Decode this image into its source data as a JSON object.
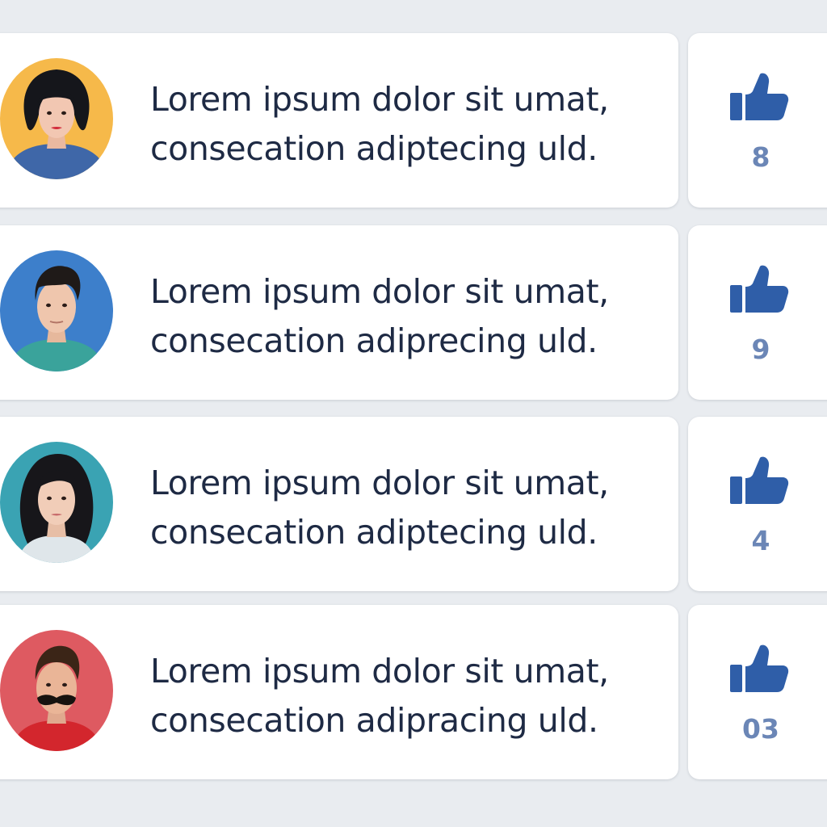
{
  "colors": {
    "background": "#e9ecf0",
    "card": "#ffffff",
    "text": "#1e2a44",
    "like_icon": "#2f5ea8",
    "like_count": "#6b86b6"
  },
  "posts": [
    {
      "avatar_icon": "avatar-woman-short-dark-hair",
      "avatar_bg": "#f6b94a",
      "text_lines": [
        "Lorem ipsum dolor sit umat,",
        "consecation adiptecing uld."
      ],
      "like_icon": "thumbs-up-icon",
      "like_count": "8"
    },
    {
      "avatar_icon": "avatar-young-man",
      "avatar_bg": "#3d7fcb",
      "text_lines": [
        "Lorem ipsum dolor sit umat,",
        "consecation adiprecing uld."
      ],
      "like_icon": "thumbs-up-icon",
      "like_count": "9"
    },
    {
      "avatar_icon": "avatar-woman-long-dark-hair",
      "avatar_bg": "#3aa3b3",
      "text_lines": [
        "Lorem ipsum dolor sit umat,",
        "consecation adiptecing uld."
      ],
      "like_icon": "thumbs-up-icon",
      "like_count": "4"
    },
    {
      "avatar_icon": "avatar-man-mustache",
      "avatar_bg": "#de5a61",
      "text_lines": [
        "Lorem ipsum dolor sit umat,",
        "consecation adipracing uld."
      ],
      "like_icon": "thumbs-up-icon",
      "like_count": "03"
    }
  ]
}
